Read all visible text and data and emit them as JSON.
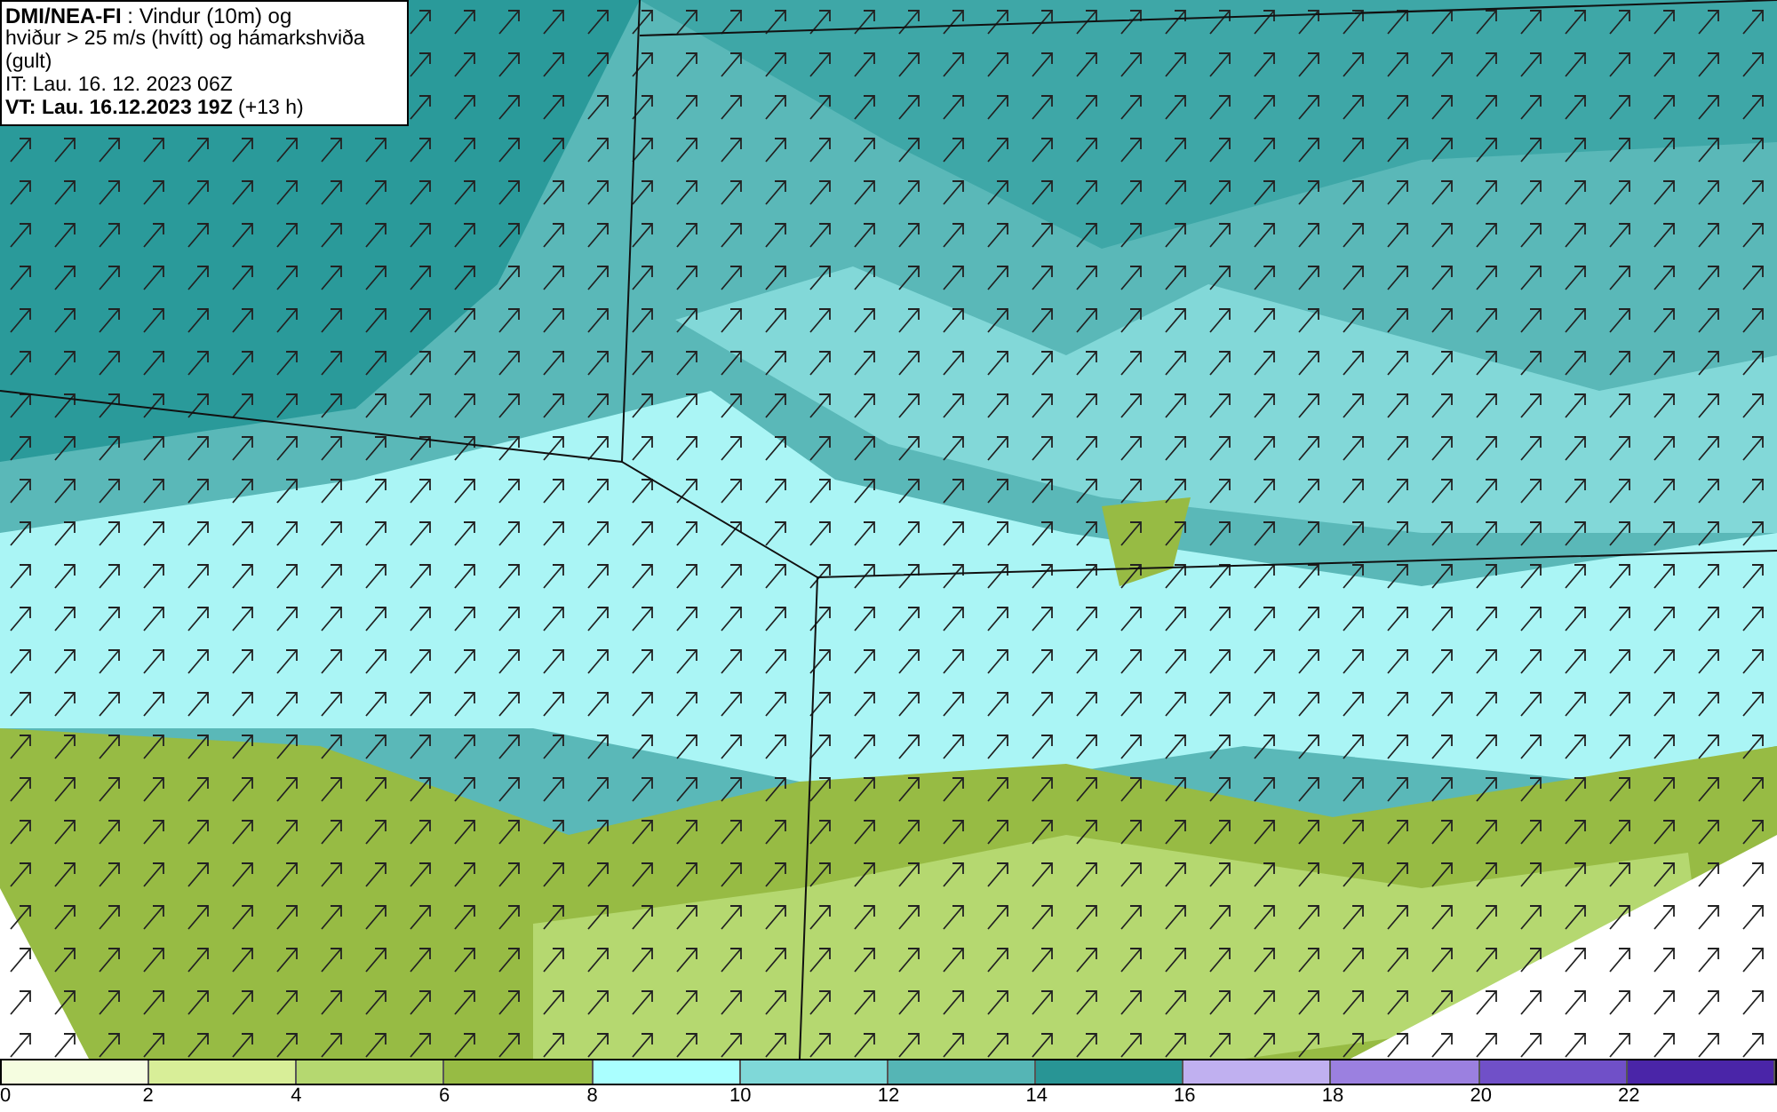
{
  "title_box": {
    "line_1": "**DMI/NEA-FI** : Vindur (10m) og",
    "line_2": "hviður > 25 m/s (hvítt) og hámarkshviða (gult)",
    "line_3": "IT: Lau. 16. 12. 2023 06Z",
    "line_4": "**VT: Lau. 16.12.2023 19Z** (+13 h)"
  },
  "legend": {
    "bins": [
      {
        "color": "#f5fde0"
      },
      {
        "color": "#d8ee98"
      },
      {
        "color": "#b5d870"
      },
      {
        "color": "#97bb44"
      },
      {
        "color": "#aaffff"
      },
      {
        "color": "#7fd8d8"
      },
      {
        "color": "#55b5b5"
      },
      {
        "color": "#289595"
      },
      {
        "color": "#c0b0f0"
      },
      {
        "color": "#9b80e0"
      },
      {
        "color": "#7050c8"
      },
      {
        "color": "#4a25a8"
      }
    ],
    "ticks": [
      "0",
      "2",
      "4",
      "6",
      "8",
      "10",
      "12",
      "14",
      "16",
      "18",
      "20",
      "22"
    ]
  }
}
